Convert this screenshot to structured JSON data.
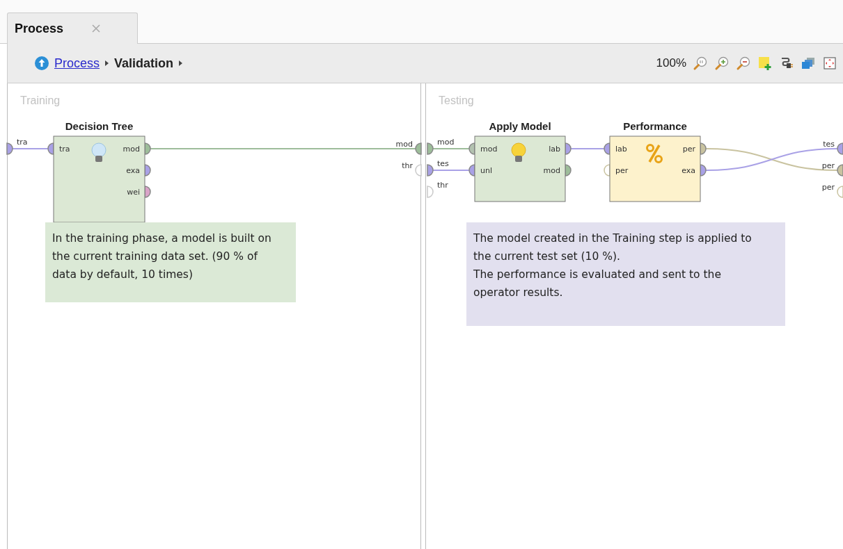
{
  "tab": {
    "title": "Process",
    "selected": true
  },
  "breadcrumb": [
    {
      "label": "Process",
      "kind": "link"
    },
    {
      "label": "Validation",
      "kind": "current"
    }
  ],
  "zoom": "100%",
  "panels": [
    {
      "title": "Training",
      "inputs": [
        {
          "label": "tra",
          "color": "#a9a1e6",
          "connected": true
        }
      ],
      "outputs": [
        {
          "label": "mod",
          "color": "#9dbd9a",
          "connected": true
        },
        {
          "label": "thr",
          "color": "#c9c9c9",
          "connected": false
        }
      ],
      "operators": [
        {
          "title": "Decision Tree",
          "kind": "learner",
          "inputs": [
            {
              "label": "tra",
              "color": "#a9a1e6",
              "connected": true
            }
          ],
          "outputs": [
            {
              "label": "mod",
              "color": "#9dbd9a",
              "connected": true
            },
            {
              "label": "exa",
              "color": "#a9a1e6",
              "connected": true
            },
            {
              "label": "wei",
              "color": "#d9a3c8",
              "connected": true
            }
          ]
        }
      ],
      "note": {
        "kind": "green",
        "paragraphs": [
          "In the training phase, a model is built on the current training data set. (90 % of data by default, 10 times)"
        ]
      }
    },
    {
      "title": "Testing",
      "inputs": [
        {
          "label": "mod",
          "color": "#9dbd9a",
          "connected": true
        },
        {
          "label": "tes",
          "color": "#a9a1e6",
          "connected": true
        },
        {
          "label": "thr",
          "color": "#c9c9c9",
          "connected": false
        }
      ],
      "outputs": [
        {
          "label": "tes",
          "color": "#a9a1e6",
          "connected": true
        },
        {
          "label": "per",
          "color": "#c9c3a0",
          "connected": true
        },
        {
          "label": "per",
          "color": "#c9c3a0",
          "connected": false
        }
      ],
      "operators": [
        {
          "title": "Apply Model",
          "kind": "applier",
          "inputs": [
            {
              "label": "mod",
              "color": "#b3c2b0",
              "connected": true
            },
            {
              "label": "unl",
              "color": "#a9a1e6",
              "connected": true
            }
          ],
          "outputs": [
            {
              "label": "lab",
              "color": "#a9a1e6",
              "connected": true
            },
            {
              "label": "mod",
              "color": "#9dbd9a",
              "connected": true
            }
          ]
        },
        {
          "title": "Performance",
          "kind": "evaluator",
          "inputs": [
            {
              "label": "lab",
              "color": "#a9a1e6",
              "connected": true
            },
            {
              "label": "per",
              "color": "#c9c3a0",
              "connected": false
            }
          ],
          "outputs": [
            {
              "label": "per",
              "color": "#c9c3a0",
              "connected": true
            },
            {
              "label": "exa",
              "color": "#a9a1e6",
              "connected": true
            }
          ]
        }
      ],
      "note": {
        "kind": "purple",
        "paragraphs": [
          "The model created in the Training step is applied to the current test set (10 %).",
          "The performance is evaluated and sent to the operator results."
        ]
      }
    }
  ]
}
